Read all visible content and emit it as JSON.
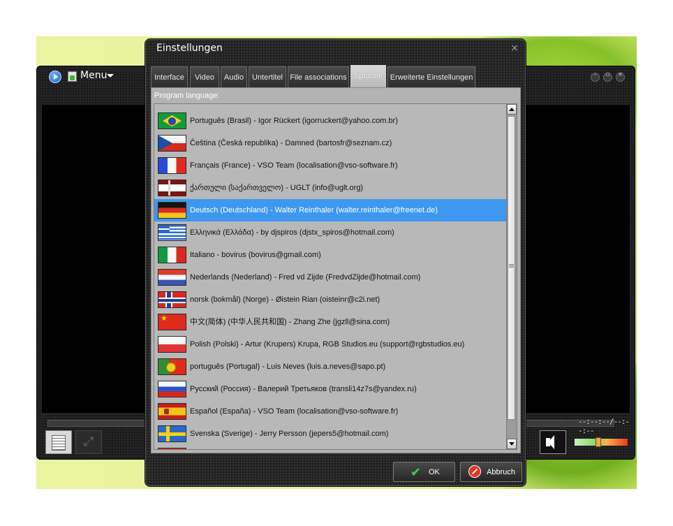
{
  "player": {
    "menu_label": "Menu",
    "time": "--:--:--/--:--:--",
    "volume_fraction": 0.45,
    "icons": [
      "player-logo-icon",
      "menu-icon",
      "minimize-icon",
      "maximize-icon",
      "close-icon",
      "playlist-icon",
      "fullscreen-icon",
      "volume-icon"
    ]
  },
  "dialog": {
    "title": "Einstellungen",
    "close_glyph": "×",
    "tabs": [
      {
        "label": "Interface",
        "active": false
      },
      {
        "label": "Video",
        "active": false
      },
      {
        "label": "Audio",
        "active": false
      },
      {
        "label": "Untertitel",
        "active": false
      },
      {
        "label": "File associations",
        "active": false
      },
      {
        "label": "Sprache",
        "active": true
      },
      {
        "label": "Erweiterte Einstellungen",
        "active": false
      }
    ],
    "panel_label": "Program language:",
    "languages": [
      {
        "flag": "br",
        "label": "Português (Brasil) - Igor Rückert (igorruckert@yahoo.com.br)",
        "selected": false
      },
      {
        "flag": "cz",
        "label": "Čeština (Česká republika) - Damned (bartosfr@seznam.cz)",
        "selected": false
      },
      {
        "flag": "fr",
        "label": "Français (France) - VSO Team (localisation@vso-software.fr)",
        "selected": false
      },
      {
        "flag": "ge",
        "label": "ქართული (საქართველო) - UGLT (info@uglt.org)",
        "selected": false
      },
      {
        "flag": "de",
        "label": "Deutsch (Deutschland) - Walter Reinthaler (walter.reinthaler@freenet.de)",
        "selected": true
      },
      {
        "flag": "gr",
        "label": "Ελληνικά (Ελλάδα) - by djspiros (djstx_spiros@hotmail.com)",
        "selected": false
      },
      {
        "flag": "it",
        "label": "Italiano - bovirus (bovirus@gmail.com)",
        "selected": false
      },
      {
        "flag": "nl",
        "label": "Nederlands (Nederland) - Fred vd Zijde (FredvdZijde@hotmail.com)",
        "selected": false
      },
      {
        "flag": "no",
        "label": "norsk (bokmål) (Norge) - Øistein Rian (oisteinr@c2i.net)",
        "selected": false
      },
      {
        "flag": "cn",
        "label": "中文(简体) (中华人民共和国) - Zhang Zhe (jgzll@sina.com)",
        "selected": false
      },
      {
        "flag": "pl",
        "label": "Polish (Polski) - Artur (Krupers) Krupa, RGB Studios.eu (support@rgbstudios.eu)",
        "selected": false
      },
      {
        "flag": "pt",
        "label": "português (Portugal) - Luis Neves (luis.a.neves@sapo.pt)",
        "selected": false
      },
      {
        "flag": "ru",
        "label": "Русский (Россия) - Валерий Третьяков (transli14z7s@yandex.ru)",
        "selected": false
      },
      {
        "flag": "es",
        "label": "Español (España) - VSO Team (localisation@vso-software.fr)",
        "selected": false
      },
      {
        "flag": "se",
        "label": "Svenska (Sverige) - Jerry Persson (jepers5@hotmail.com)",
        "selected": false
      },
      {
        "flag": "ar",
        "label": "",
        "selected": false
      }
    ],
    "ok_label": "OK",
    "cancel_label": "Abbruch",
    "ok_icon": "checkmark-icon",
    "cancel_icon": "cancel-icon"
  }
}
